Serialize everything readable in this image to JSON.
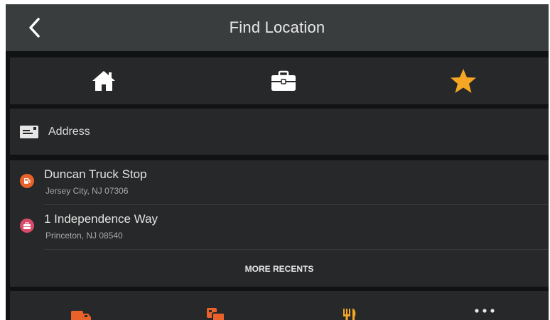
{
  "header": {
    "title": "Find Location"
  },
  "favorites_tabs": [
    {
      "icon": "home-icon",
      "color": "#ffffff"
    },
    {
      "icon": "briefcase-icon",
      "color": "#ffffff"
    },
    {
      "icon": "star-icon",
      "color": "#f5a623"
    }
  ],
  "address": {
    "label": "Address",
    "icon": "address-card-icon"
  },
  "recents": {
    "items": [
      {
        "name": "Duncan Truck Stop",
        "address": "Jersey City, NJ 07306",
        "icon": "fuel-pin-icon",
        "color": "#e8622a"
      },
      {
        "name": "1 Independence Way",
        "address": "Princeton, NJ 08540",
        "icon": "briefcase-pin-icon",
        "color": "#d94a6a"
      }
    ],
    "more_label": "MORE RECENTS"
  },
  "categories": [
    {
      "icon": "truck-icon"
    },
    {
      "icon": "truck-stop-icon"
    },
    {
      "icon": "food-icon"
    },
    {
      "icon": "more-icon"
    }
  ],
  "colors": {
    "accent_orange": "#e8622a",
    "star": "#f5a623",
    "header_bg": "#3a3d3e",
    "panel_bg": "#272829"
  }
}
